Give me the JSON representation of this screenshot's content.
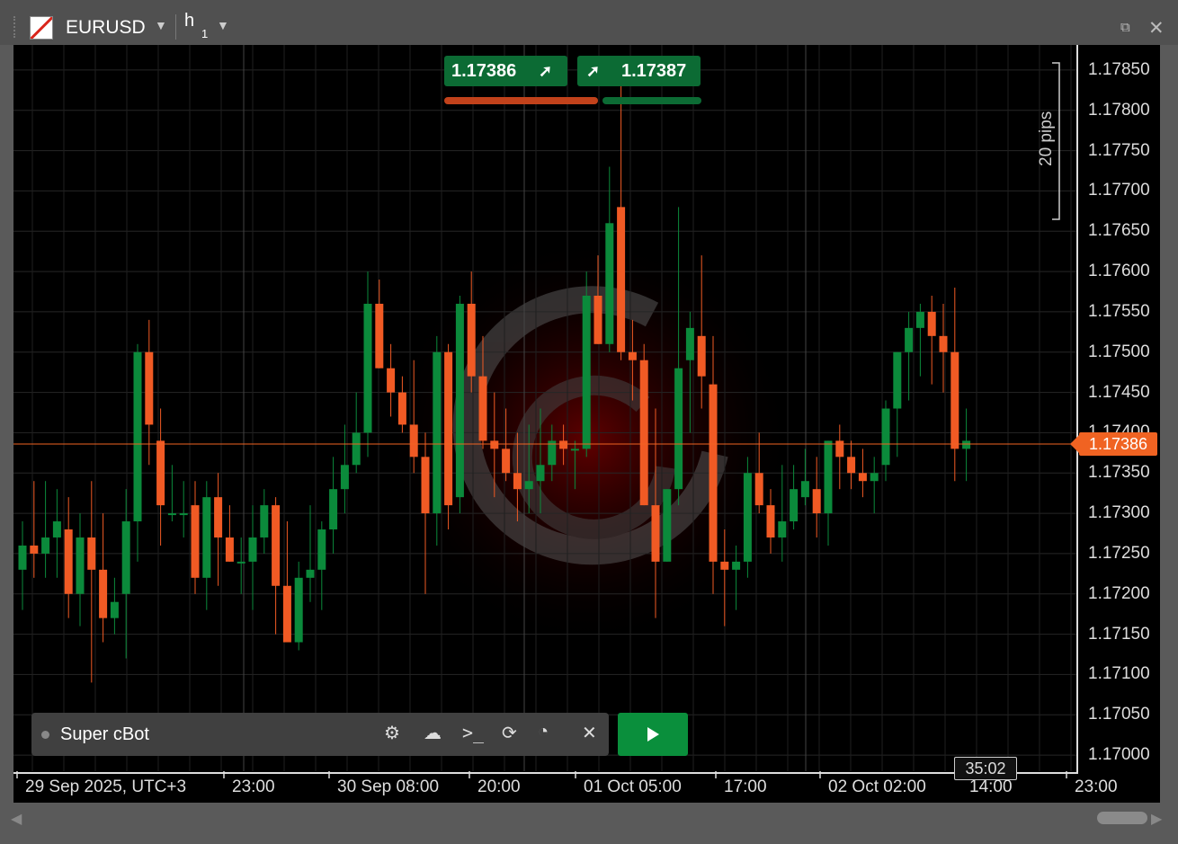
{
  "window": {
    "symbol": "EURUSD",
    "timeframe_main": "h",
    "timeframe_sub": "1",
    "detach_icon": "external-link-icon",
    "close_icon": "close-icon"
  },
  "quote": {
    "bid": "1.17386",
    "ask": "1.17387",
    "current_price": "1.17386",
    "pips_label": "20 pips",
    "countdown": "35:02"
  },
  "bot": {
    "name": "Super cBot",
    "icons": [
      "gear-icon",
      "cloud-icon",
      "terminal-icon",
      "history-icon",
      "speedometer-icon",
      "close-icon",
      "play-icon"
    ]
  },
  "price_axis": [
    "1.17850",
    "1.17800",
    "1.17750",
    "1.17700",
    "1.17650",
    "1.17600",
    "1.17550",
    "1.17500",
    "1.17450",
    "1.17400",
    "1.17350",
    "1.17300",
    "1.17250",
    "1.17200",
    "1.17150",
    "1.17100",
    "1.17050",
    "1.17000"
  ],
  "time_axis": [
    "29 Sep 2025, UTC+3",
    "23:00",
    "30 Sep 08:00",
    "20:00",
    "01 Oct 05:00",
    "17:00",
    "02 Oct 02:00",
    "14:00",
    "23:00"
  ],
  "colors": {
    "bull": "#0b8a3b",
    "bear": "#f05a24",
    "background": "#000000"
  },
  "chart_data": {
    "type": "candlestick",
    "x_axis_labels": [
      "29 Sep 2025, UTC+3",
      "23:00",
      "30 Sep 08:00",
      "20:00",
      "01 Oct 05:00",
      "17:00",
      "02 Oct 02:00",
      "14:00",
      "23:00"
    ],
    "ylim": [
      1.1698,
      1.1787
    ],
    "candles": [
      [
        1.1723,
        1.1729,
        1.1718,
        1.1726
      ],
      [
        1.1726,
        1.1734,
        1.1722,
        1.1725
      ],
      [
        1.1725,
        1.1734,
        1.1722,
        1.1727
      ],
      [
        1.1727,
        1.1733,
        1.1722,
        1.1729
      ],
      [
        1.1728,
        1.1732,
        1.1717,
        1.172
      ],
      [
        1.172,
        1.173,
        1.1716,
        1.1727
      ],
      [
        1.1727,
        1.1734,
        1.1709,
        1.1723
      ],
      [
        1.1723,
        1.173,
        1.1714,
        1.1717
      ],
      [
        1.1717,
        1.1722,
        1.1715,
        1.1719
      ],
      [
        1.172,
        1.1733,
        1.1712,
        1.1729
      ],
      [
        1.1729,
        1.1751,
        1.1724,
        1.175
      ],
      [
        1.175,
        1.1754,
        1.1736,
        1.1741
      ],
      [
        1.1739,
        1.1743,
        1.1726,
        1.1731
      ],
      [
        1.173,
        1.1736,
        1.1729,
        1.173
      ],
      [
        1.173,
        1.1734,
        1.1727,
        1.173
      ],
      [
        1.1731,
        1.1734,
        1.172,
        1.1722
      ],
      [
        1.1722,
        1.1734,
        1.1718,
        1.1732
      ],
      [
        1.1732,
        1.1735,
        1.1721,
        1.1727
      ],
      [
        1.1727,
        1.1731,
        1.1724,
        1.1724
      ],
      [
        1.1724,
        1.1727,
        1.172,
        1.1724
      ],
      [
        1.1724,
        1.1731,
        1.1718,
        1.1727
      ],
      [
        1.1727,
        1.1733,
        1.1725,
        1.1731
      ],
      [
        1.1731,
        1.1732,
        1.1715,
        1.1721
      ],
      [
        1.1721,
        1.1729,
        1.1714,
        1.1714
      ],
      [
        1.1714,
        1.1724,
        1.1713,
        1.1722
      ],
      [
        1.1722,
        1.1731,
        1.1719,
        1.1723
      ],
      [
        1.1723,
        1.1729,
        1.1718,
        1.1728
      ],
      [
        1.1728,
        1.1737,
        1.1725,
        1.1733
      ],
      [
        1.1733,
        1.1741,
        1.173,
        1.1736
      ],
      [
        1.1736,
        1.1745,
        1.1735,
        1.174
      ],
      [
        1.174,
        1.176,
        1.1737,
        1.1756
      ],
      [
        1.1756,
        1.1759,
        1.1748,
        1.1748
      ],
      [
        1.1748,
        1.1751,
        1.1742,
        1.1745
      ],
      [
        1.1745,
        1.1747,
        1.174,
        1.1741
      ],
      [
        1.1741,
        1.1749,
        1.1735,
        1.1737
      ],
      [
        1.1737,
        1.174,
        1.172,
        1.173
      ],
      [
        1.173,
        1.1752,
        1.1726,
        1.175
      ],
      [
        1.175,
        1.1751,
        1.1728,
        1.1731
      ],
      [
        1.1732,
        1.1757,
        1.173,
        1.1756
      ],
      [
        1.1756,
        1.176,
        1.1745,
        1.1747
      ],
      [
        1.1747,
        1.1752,
        1.1738,
        1.1739
      ],
      [
        1.1739,
        1.1745,
        1.1732,
        1.1738
      ],
      [
        1.1738,
        1.1743,
        1.1734,
        1.1735
      ],
      [
        1.1735,
        1.174,
        1.1729,
        1.1733
      ],
      [
        1.1733,
        1.1741,
        1.173,
        1.1734
      ],
      [
        1.1734,
        1.1743,
        1.173,
        1.1736
      ],
      [
        1.1736,
        1.1741,
        1.1734,
        1.1739
      ],
      [
        1.1739,
        1.1741,
        1.1736,
        1.1738
      ],
      [
        1.1738,
        1.1739,
        1.1733,
        1.1738
      ],
      [
        1.1738,
        1.176,
        1.1737,
        1.1757
      ],
      [
        1.1757,
        1.1762,
        1.1751,
        1.1751
      ],
      [
        1.1751,
        1.1773,
        1.175,
        1.1766
      ],
      [
        1.1768,
        1.1783,
        1.1749,
        1.175
      ],
      [
        1.175,
        1.1754,
        1.1744,
        1.1749
      ],
      [
        1.1749,
        1.1751,
        1.1731,
        1.1731
      ],
      [
        1.1731,
        1.1743,
        1.1717,
        1.1724
      ],
      [
        1.1724,
        1.1733,
        1.1724,
        1.1733
      ],
      [
        1.1733,
        1.1768,
        1.1731,
        1.1748
      ],
      [
        1.1749,
        1.1755,
        1.174,
        1.1753
      ],
      [
        1.1752,
        1.1762,
        1.1743,
        1.1747
      ],
      [
        1.1746,
        1.1752,
        1.172,
        1.1724
      ],
      [
        1.1724,
        1.1728,
        1.1716,
        1.1723
      ],
      [
        1.1723,
        1.1726,
        1.1718,
        1.1724
      ],
      [
        1.1724,
        1.1737,
        1.1722,
        1.1735
      ],
      [
        1.1735,
        1.174,
        1.173,
        1.1731
      ],
      [
        1.1731,
        1.1733,
        1.1725,
        1.1727
      ],
      [
        1.1727,
        1.1736,
        1.1724,
        1.1729
      ],
      [
        1.1729,
        1.1736,
        1.1728,
        1.1733
      ],
      [
        1.1732,
        1.1738,
        1.1731,
        1.1734
      ],
      [
        1.1733,
        1.1737,
        1.1727,
        1.173
      ],
      [
        1.173,
        1.1739,
        1.1726,
        1.1739
      ],
      [
        1.1739,
        1.1741,
        1.1733,
        1.1737
      ],
      [
        1.1737,
        1.1739,
        1.1733,
        1.1735
      ],
      [
        1.1735,
        1.1738,
        1.1732,
        1.1734
      ],
      [
        1.1734,
        1.1737,
        1.173,
        1.1735
      ],
      [
        1.1736,
        1.1744,
        1.1734,
        1.1743
      ],
      [
        1.1743,
        1.175,
        1.1737,
        1.175
      ],
      [
        1.175,
        1.1755,
        1.1744,
        1.1753
      ],
      [
        1.1753,
        1.1756,
        1.1747,
        1.1755
      ],
      [
        1.1755,
        1.1757,
        1.1746,
        1.1752
      ],
      [
        1.1752,
        1.1756,
        1.1745,
        1.175
      ],
      [
        1.175,
        1.1758,
        1.1734,
        1.1738
      ],
      [
        1.1738,
        1.1743,
        1.1734,
        1.1739
      ]
    ]
  }
}
